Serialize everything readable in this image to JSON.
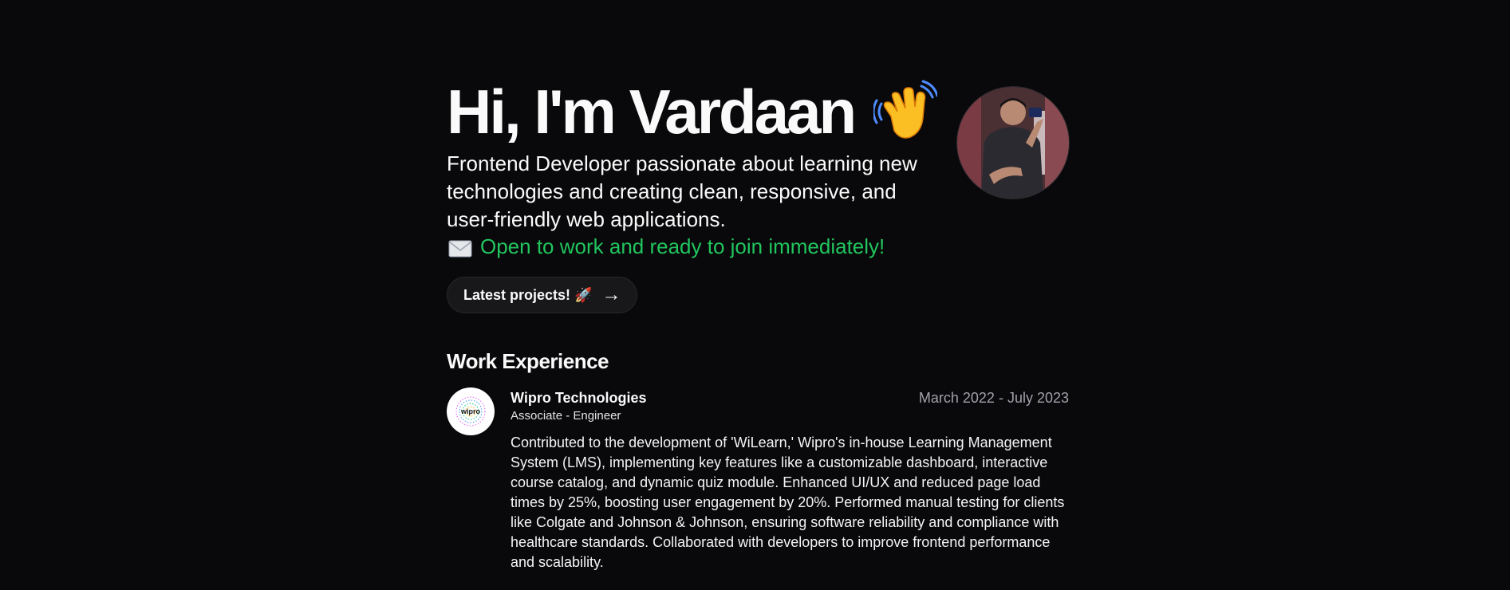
{
  "hero": {
    "title": "Hi, I'm Vardaan",
    "wave_icon": "waving-hand-icon",
    "tagline": "Frontend Developer passionate about learning new technologies and creating clean, responsive, and user-friendly web applications.",
    "availability": "Open to work and ready to join immediately!",
    "availability_icon": "envelope-icon",
    "availability_color": "#22c55e",
    "cta_label": "Latest projects! 🚀",
    "cta_arrow": "→"
  },
  "work": {
    "section_title": "Work Experience",
    "jobs": [
      {
        "logo_text": "wipro",
        "company": "Wipro Technologies",
        "role": "Associate - Engineer",
        "dates": "March 2022 - July 2023",
        "description": "Contributed to the development of 'WiLearn,' Wipro's in-house Learning Management System (LMS), implementing key features like a customizable dashboard, interactive course catalog, and dynamic quiz module. Enhanced UI/UX and reduced page load times by 25%, boosting user engagement by 20%. Performed manual testing for clients like Colgate and Johnson & Johnson, ensuring software reliability and compliance with healthcare standards. Collaborated with developers to improve frontend performance and scalability."
      }
    ]
  },
  "colors": {
    "background": "#09090b",
    "text": "#fafafa",
    "muted": "#a1a1aa",
    "button_bg": "#18181b"
  }
}
